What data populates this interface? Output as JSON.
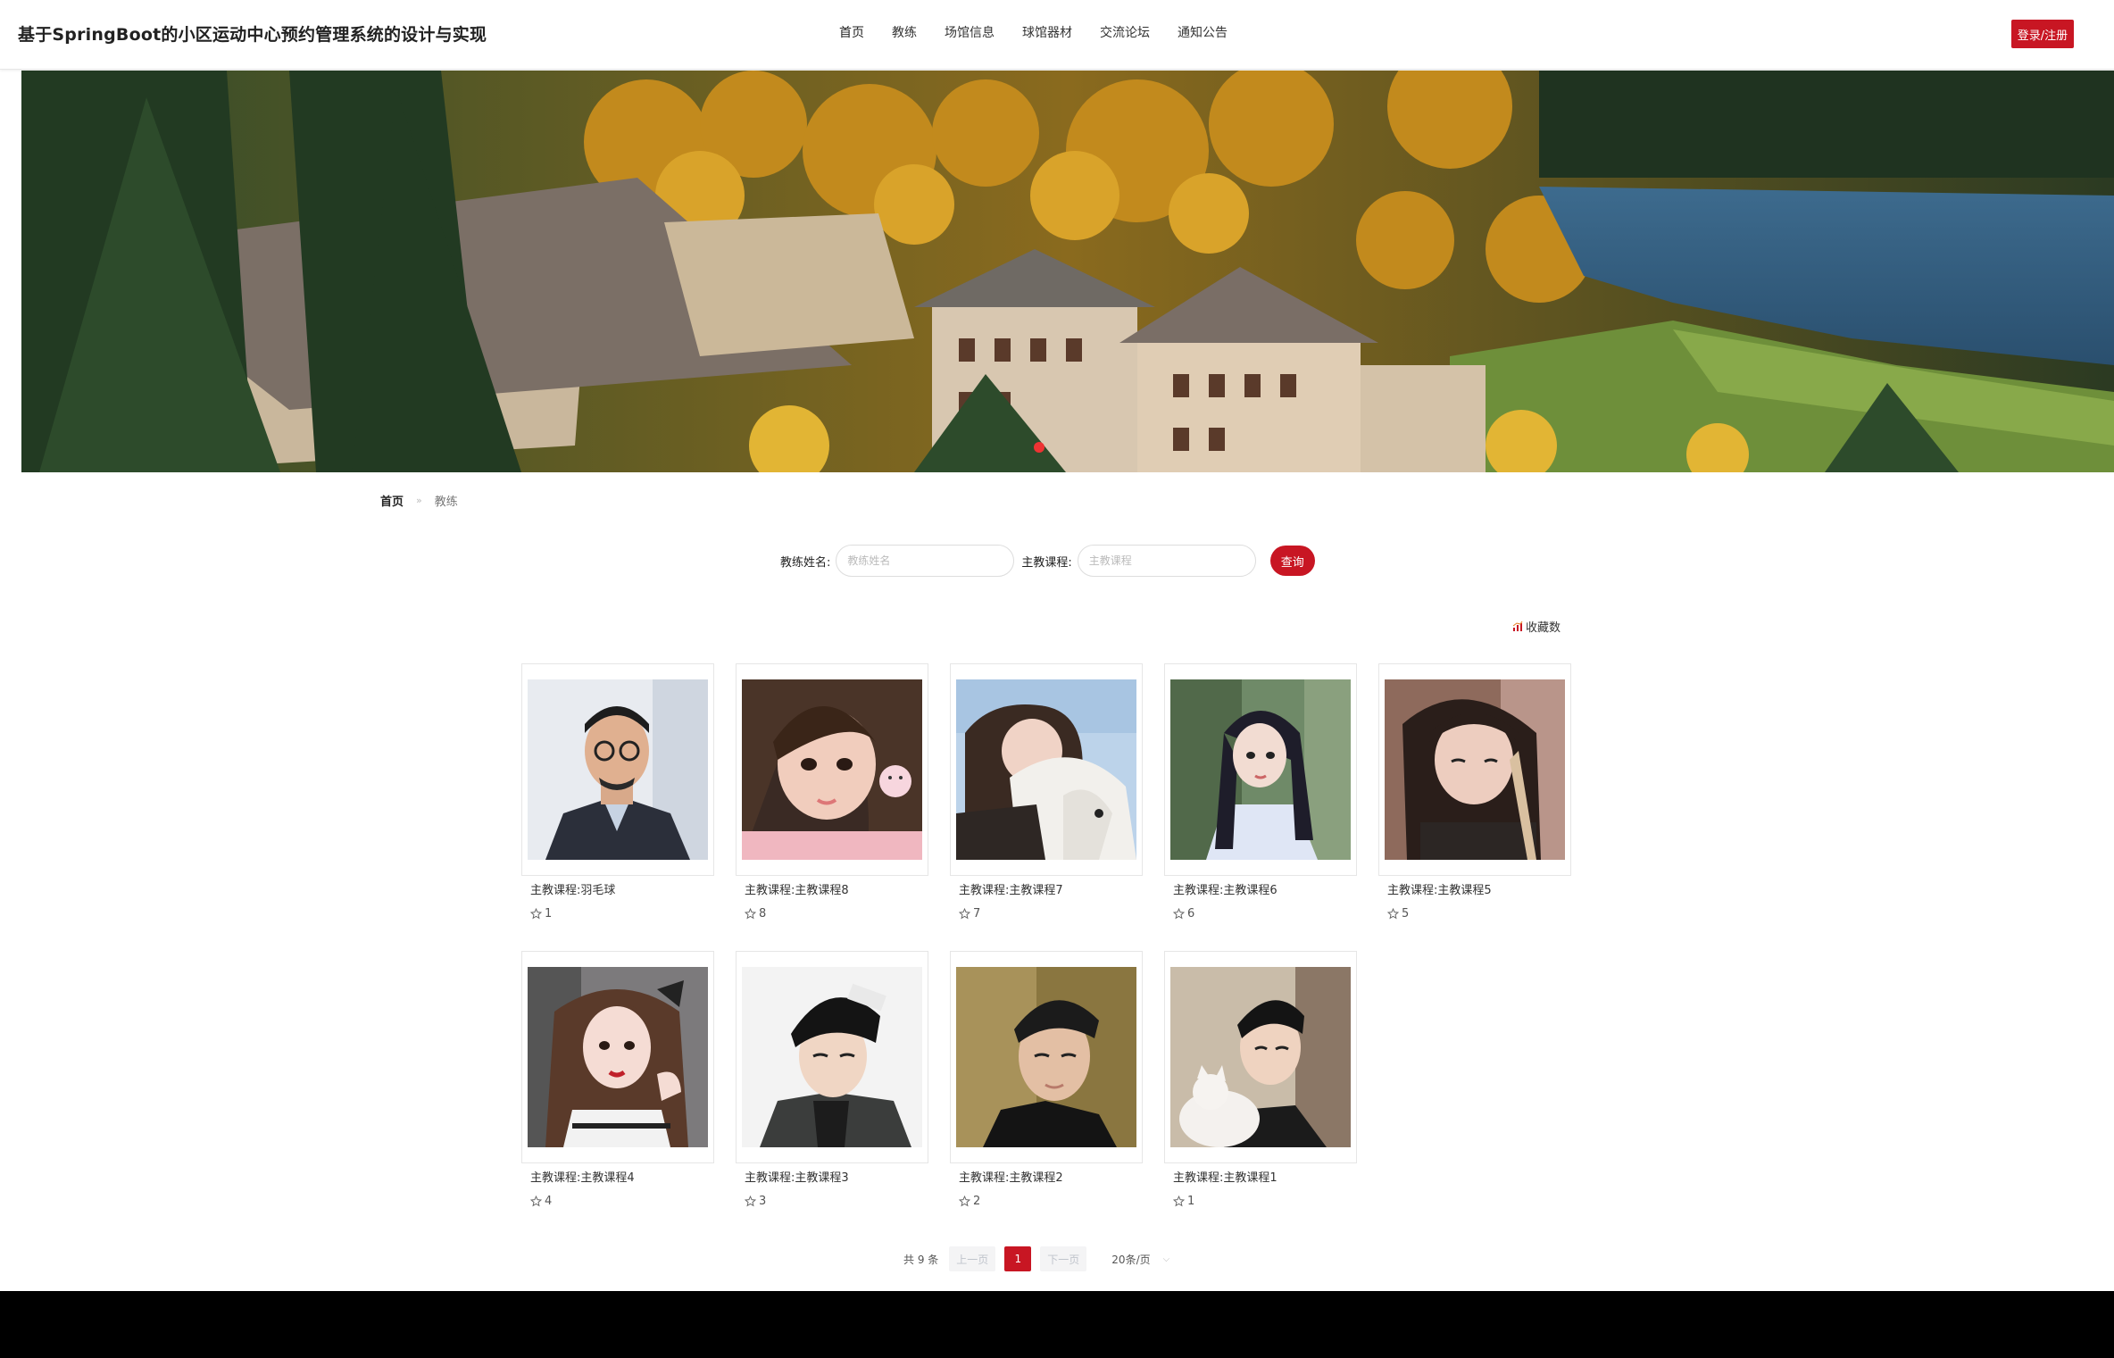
{
  "header": {
    "site_title": "基于SpringBoot的小区运动中心预约管理系统的设计与实现",
    "nav": [
      "首页",
      "教练",
      "场馆信息",
      "球馆器材",
      "交流论坛",
      "通知公告"
    ],
    "login_label": "登录/注册",
    "accent_color": "#c81623"
  },
  "breadcrumb": {
    "home": "首页",
    "separator": "»",
    "current": "教练"
  },
  "search": {
    "name_label": "教练姓名:",
    "name_placeholder": "教练姓名",
    "course_label": "主教课程:",
    "course_placeholder": "主教课程",
    "button_label": "查询"
  },
  "sort": {
    "label": "收藏数",
    "icon": "sort-chart-icon"
  },
  "coaches": [
    {
      "course": "主教课程:羽毛球",
      "favorites": "1"
    },
    {
      "course": "主教课程:主教课程8",
      "favorites": "8"
    },
    {
      "course": "主教课程:主教课程7",
      "favorites": "7"
    },
    {
      "course": "主教课程:主教课程6",
      "favorites": "6"
    },
    {
      "course": "主教课程:主教课程5",
      "favorites": "5"
    },
    {
      "course": "主教课程:主教课程4",
      "favorites": "4"
    },
    {
      "course": "主教课程:主教课程3",
      "favorites": "3"
    },
    {
      "course": "主教课程:主教课程2",
      "favorites": "2"
    },
    {
      "course": "主教课程:主教课程1",
      "favorites": "1"
    }
  ],
  "pagination": {
    "total": "共 9 条",
    "prev": "上一页",
    "current": "1",
    "next": "下一页",
    "page_size": "20条/页"
  }
}
